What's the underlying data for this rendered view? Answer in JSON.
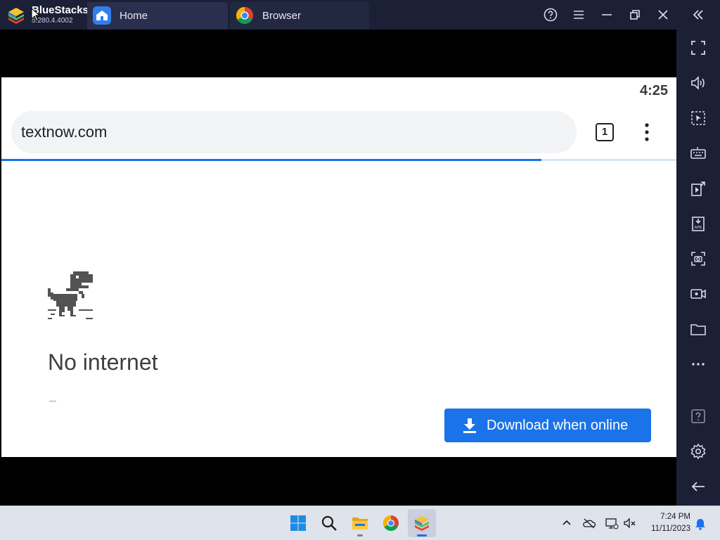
{
  "titlebar": {
    "app_name": "BlueStacks",
    "app_version": "5.280.4.4002",
    "tabs": [
      {
        "label": "Home",
        "icon": "home-icon"
      },
      {
        "label": "Browser",
        "icon": "chrome-icon"
      }
    ],
    "buttons": [
      "help-icon",
      "menu-icon",
      "minimize-icon",
      "restore-icon",
      "close-icon",
      "collapse-sidebar-icon"
    ]
  },
  "sidebar": {
    "items": [
      "fullscreen-icon",
      "volume-icon",
      "pointer-select-icon",
      "keyboard-icon",
      "media-manager-icon",
      "install-apk-icon",
      "screenshot-icon",
      "record-icon",
      "folder-icon",
      "more-icon",
      "help-icon",
      "settings-icon",
      "back-icon"
    ]
  },
  "android": {
    "clock": "4:25",
    "url": "textnow.com",
    "tab_count": "1",
    "progress_fraction": 0.8,
    "error_title": "No internet",
    "download_button": "Download when online"
  },
  "taskbar": {
    "apps": [
      "start-icon",
      "search-icon",
      "file-explorer-icon",
      "chrome-icon",
      "bluestacks-icon"
    ],
    "active_app": "bluestacks-icon",
    "time": "7:24 PM",
    "date": "11/11/2023"
  },
  "colors": {
    "titlebar_bg": "#1c2036",
    "accent_blue": "#1a73e8",
    "taskbar_bg": "#dfe3ec"
  }
}
